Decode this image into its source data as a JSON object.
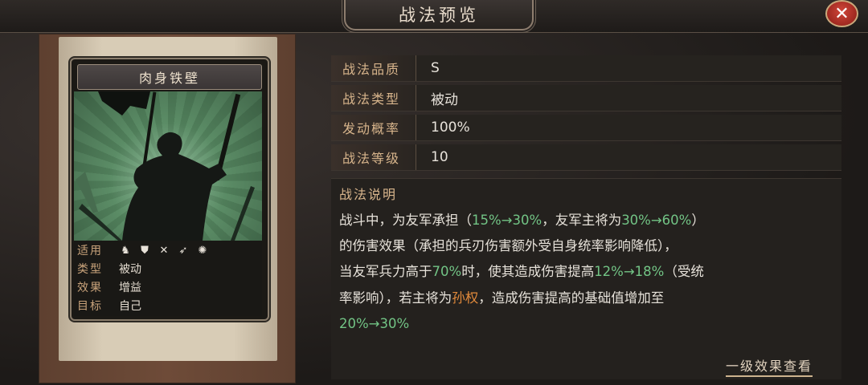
{
  "window": {
    "title": "战法预览",
    "close_label": "✕"
  },
  "card": {
    "name": "肉身铁壁",
    "info": [
      {
        "key": "适用",
        "value": ""
      },
      {
        "key": "类型",
        "value": "被动"
      },
      {
        "key": "效果",
        "value": "增益"
      },
      {
        "key": "目标",
        "value": "自己"
      }
    ],
    "troop_icons": [
      "cavalry-icon",
      "shield-icon",
      "crossed-swords-icon",
      "spear-icon",
      "wheel-icon"
    ]
  },
  "stats": [
    {
      "label": "战法品质",
      "value": "S"
    },
    {
      "label": "战法类型",
      "value": "被动"
    },
    {
      "label": "发动概率",
      "value": "100%"
    },
    {
      "label": "战法等级",
      "value": "10"
    }
  ],
  "description": {
    "title": "战法说明",
    "line1_a": "战斗中，为友军承担（",
    "line1_b": "15%→30%",
    "line1_c": "，友军主将为",
    "line1_d": "30%→60%",
    "line1_e": "）",
    "line2": "的伤害效果（承担的兵刃伤害额外受自身统率影响降低），",
    "line3_a": "当友军兵力高于",
    "line3_b": "70%",
    "line3_c": "时，使其造成伤害提高",
    "line3_d": "12%→18%",
    "line3_e": "（受统",
    "line4_a": "率影响），若主将为",
    "line4_b": "孙权",
    "line4_c": "，造成伤害提高的基础值增加至",
    "line5": "20%→30%"
  },
  "footer": {
    "more_label": "一级效果查看"
  },
  "colors": {
    "highlight_green": "#72c485",
    "highlight_orange": "#e28a3b",
    "label_gold": "#d8b58c"
  }
}
